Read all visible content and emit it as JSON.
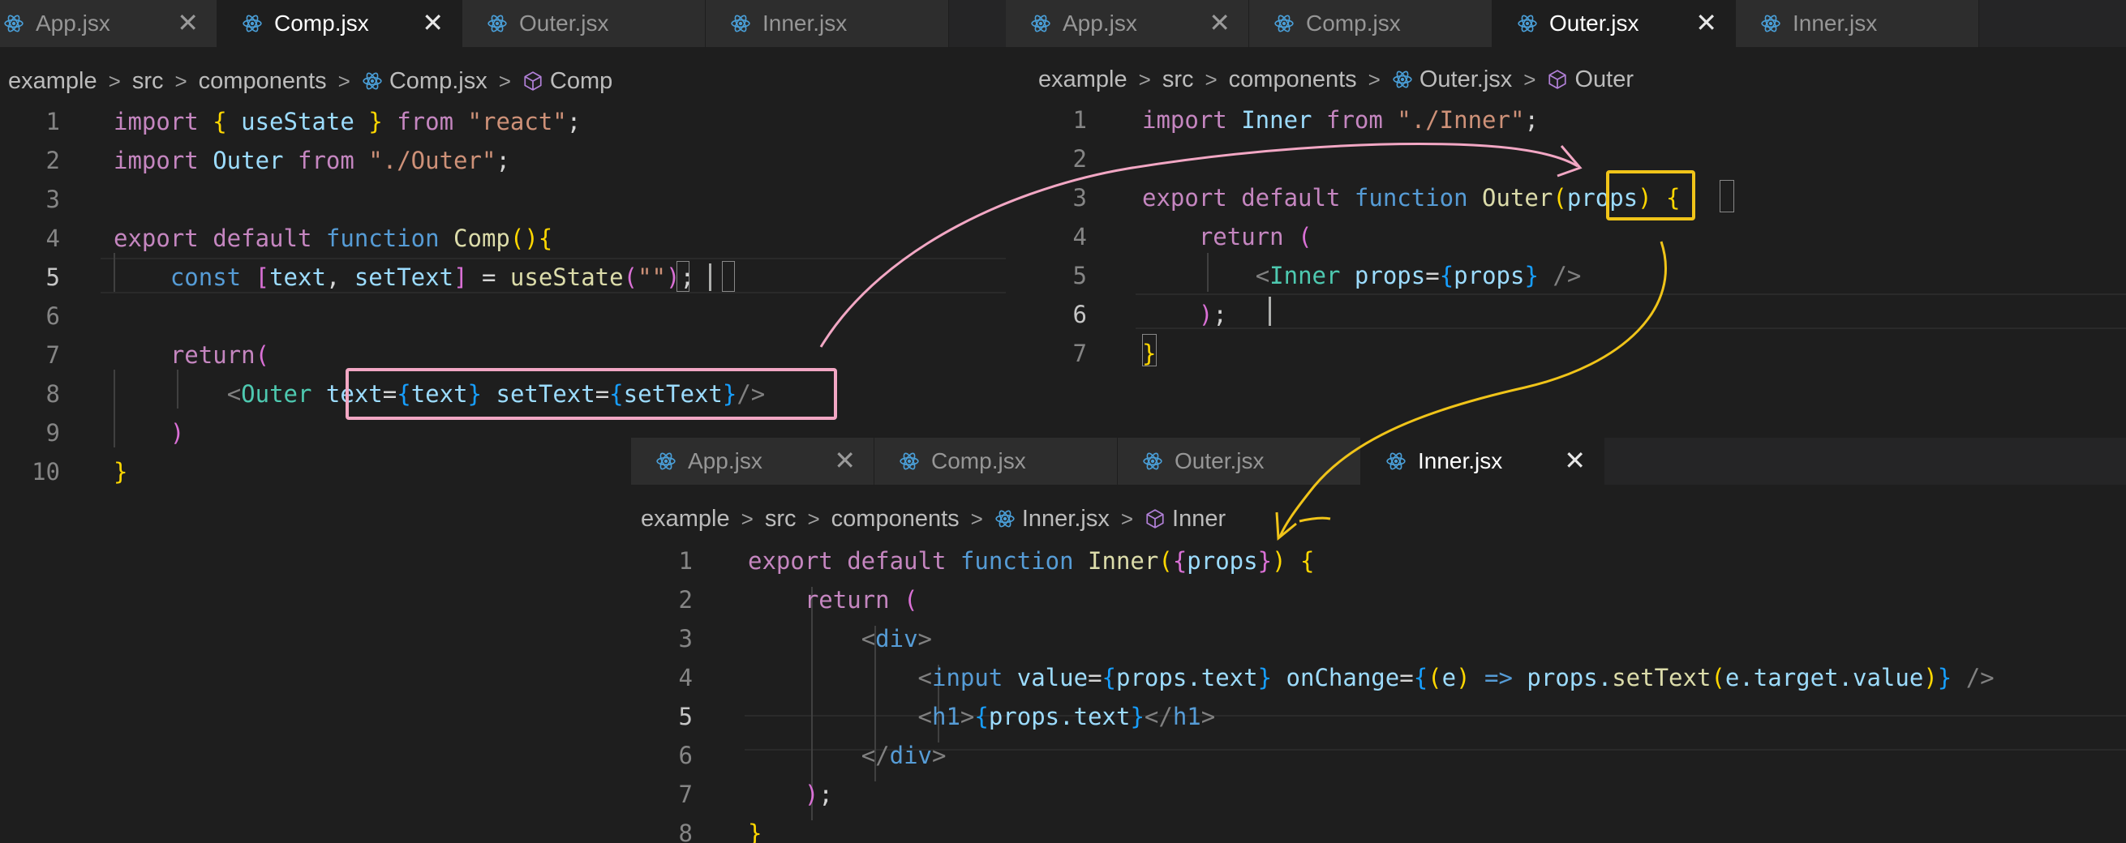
{
  "tab_labels": [
    "App.jsx",
    "Comp.jsx",
    "Outer.jsx",
    "Inner.jsx"
  ],
  "close_glyph": "✕",
  "breadcrumb": {
    "root": "example",
    "src": "src",
    "components": "components",
    "separator": ">"
  },
  "panes": {
    "comp": {
      "active_tab": "Comp.jsx",
      "breadcrumb_file": "Comp.jsx",
      "breadcrumb_symbol": "Comp",
      "line_numbers": [
        "1",
        "2",
        "3",
        "4",
        "5",
        "6",
        "7",
        "8",
        "9",
        "10"
      ],
      "current_line": "5"
    },
    "outer": {
      "active_tab": "Outer.jsx",
      "breadcrumb_file": "Outer.jsx",
      "breadcrumb_symbol": "Outer",
      "line_numbers": [
        "1",
        "2",
        "3",
        "4",
        "5",
        "6",
        "7"
      ],
      "current_line": "6"
    },
    "inner": {
      "active_tab": "Inner.jsx",
      "breadcrumb_file": "Inner.jsx",
      "breadcrumb_symbol": "Inner",
      "line_numbers": [
        "1",
        "2",
        "3",
        "4",
        "5",
        "6",
        "7",
        "8"
      ],
      "current_line": "5"
    }
  },
  "code": {
    "comp": [
      [
        [
          "k",
          "import "
        ],
        [
          "y",
          "{ "
        ],
        [
          "v",
          "useState"
        ],
        [
          "y",
          " } "
        ],
        [
          "k",
          "from "
        ],
        [
          "s",
          "\"react\""
        ],
        [
          "p",
          ";"
        ]
      ],
      [
        [
          "k",
          "import "
        ],
        [
          "v",
          "Outer "
        ],
        [
          "k",
          "from "
        ],
        [
          "s",
          "\"./Outer\""
        ],
        [
          "p",
          ";"
        ]
      ],
      [],
      [
        [
          "k",
          "export default "
        ],
        [
          "b",
          "function "
        ],
        [
          "f",
          "Comp"
        ],
        [
          "y",
          "(){"
        ]
      ],
      [
        [
          "p",
          "    "
        ],
        [
          "b",
          "const "
        ],
        [
          "m",
          "["
        ],
        [
          "v",
          "text"
        ],
        [
          "p",
          ", "
        ],
        [
          "v",
          "setText"
        ],
        [
          "m",
          "]"
        ],
        [
          "p",
          " = "
        ],
        [
          "f",
          "useState"
        ],
        [
          "m",
          "("
        ],
        [
          "s",
          "\"\""
        ],
        [
          "m",
          ")"
        ],
        [
          "p",
          ";"
        ]
      ],
      [],
      [
        [
          "p",
          "    "
        ],
        [
          "k",
          "return"
        ],
        [
          "m",
          "("
        ]
      ],
      [
        [
          "p",
          "        "
        ],
        [
          "tg",
          "<"
        ],
        [
          "t",
          "Outer "
        ],
        [
          "v",
          "text"
        ],
        [
          "p",
          "="
        ],
        [
          "c",
          "{"
        ],
        [
          "v",
          "text"
        ],
        [
          "c",
          "}"
        ],
        [
          "p",
          " "
        ],
        [
          "v",
          "setText"
        ],
        [
          "p",
          "="
        ],
        [
          "c",
          "{"
        ],
        [
          "v",
          "setText"
        ],
        [
          "c",
          "}"
        ],
        [
          "tg",
          "/>"
        ]
      ],
      [
        [
          "p",
          "    "
        ],
        [
          "m",
          ")"
        ]
      ],
      [
        [
          "y",
          "}"
        ]
      ]
    ],
    "outer": [
      [
        [
          "k",
          "import "
        ],
        [
          "v",
          "Inner "
        ],
        [
          "k",
          "from "
        ],
        [
          "s",
          "\"./Inner\""
        ],
        [
          "p",
          ";"
        ]
      ],
      [],
      [
        [
          "k",
          "export default "
        ],
        [
          "b",
          "function "
        ],
        [
          "f",
          "Outer"
        ],
        [
          "y",
          "("
        ],
        [
          "v",
          "props"
        ],
        [
          "y",
          ") {"
        ]
      ],
      [
        [
          "p",
          "    "
        ],
        [
          "k",
          "return "
        ],
        [
          "m",
          "("
        ]
      ],
      [
        [
          "p",
          "        "
        ],
        [
          "tg",
          "<"
        ],
        [
          "t",
          "Inner "
        ],
        [
          "v",
          "props"
        ],
        [
          "p",
          "="
        ],
        [
          "c",
          "{"
        ],
        [
          "v",
          "props"
        ],
        [
          "c",
          "}"
        ],
        [
          "tg",
          " />"
        ]
      ],
      [
        [
          "p",
          "    "
        ],
        [
          "m",
          ")"
        ],
        [
          "p",
          ";"
        ]
      ],
      [
        [
          "y",
          "}"
        ]
      ]
    ],
    "inner": [
      [
        [
          "k",
          "export default "
        ],
        [
          "b",
          "function "
        ],
        [
          "f",
          "Inner"
        ],
        [
          "y",
          "("
        ],
        [
          "m",
          "{"
        ],
        [
          "v",
          "props"
        ],
        [
          "m",
          "}"
        ],
        [
          "y",
          ") {"
        ]
      ],
      [
        [
          "p",
          "    "
        ],
        [
          "k",
          "return "
        ],
        [
          "m",
          "("
        ]
      ],
      [
        [
          "p",
          "        "
        ],
        [
          "tg",
          "<"
        ],
        [
          "b",
          "div"
        ],
        [
          "tg",
          ">"
        ]
      ],
      [
        [
          "p",
          "            "
        ],
        [
          "tg",
          "<"
        ],
        [
          "b",
          "input "
        ],
        [
          "v",
          "value"
        ],
        [
          "p",
          "="
        ],
        [
          "c",
          "{"
        ],
        [
          "v",
          "props.text"
        ],
        [
          "c",
          "}"
        ],
        [
          "p",
          " "
        ],
        [
          "v",
          "onChange"
        ],
        [
          "p",
          "="
        ],
        [
          "c",
          "{"
        ],
        [
          "y",
          "("
        ],
        [
          "v",
          "e"
        ],
        [
          "y",
          ")"
        ],
        [
          "b",
          " => "
        ],
        [
          "v",
          "props."
        ],
        [
          "f",
          "setText"
        ],
        [
          "y",
          "("
        ],
        [
          "v",
          "e.target.value"
        ],
        [
          "y",
          ")"
        ],
        [
          "c",
          "}"
        ],
        [
          "tg",
          " />"
        ]
      ],
      [
        [
          "p",
          "            "
        ],
        [
          "tg",
          "<"
        ],
        [
          "b",
          "h1"
        ],
        [
          "tg",
          ">"
        ],
        [
          "c",
          "{"
        ],
        [
          "v",
          "props.text"
        ],
        [
          "c",
          "}"
        ],
        [
          "tg",
          "</"
        ],
        [
          "b",
          "h1"
        ],
        [
          "tg",
          ">"
        ]
      ],
      [
        [
          "p",
          "        "
        ],
        [
          "tg",
          "</"
        ],
        [
          "b",
          "div"
        ],
        [
          "tg",
          ">"
        ]
      ],
      [
        [
          "p",
          "    "
        ],
        [
          "m",
          ")"
        ],
        [
          "p",
          ";"
        ]
      ],
      [
        [
          "y",
          "}"
        ]
      ]
    ]
  },
  "colors": {
    "pink_annotation": "#f2a7c4",
    "yellow_annotation": "#f0c419",
    "keyword": "#c586c0",
    "storage": "#569cd6",
    "function": "#dcdcaa",
    "variable": "#9cdcfe",
    "component": "#4ec9b0",
    "string": "#ce9178",
    "react_icon": "#4a9fd8"
  },
  "icons": {
    "tab": "react-icon",
    "breadcrumb_symbol": "symbol-cube-icon"
  }
}
